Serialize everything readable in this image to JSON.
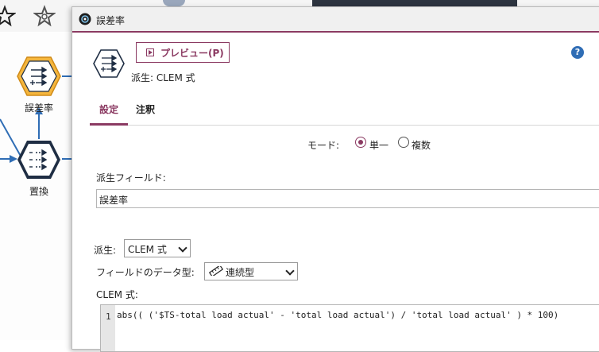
{
  "background": {
    "nodes": [
      {
        "label": "誤差率"
      },
      {
        "label": "置換"
      }
    ]
  },
  "dialog": {
    "title": "誤差率",
    "preview_label": "プレビュー(P)",
    "subtitle": "派生: CLEM 式",
    "help": "?",
    "tabs": [
      {
        "label": "設定",
        "active": true
      },
      {
        "label": "注釈",
        "active": false
      }
    ],
    "mode": {
      "label": "モード:",
      "options": [
        {
          "label": "単一",
          "selected": true
        },
        {
          "label": "複数",
          "selected": false
        }
      ]
    },
    "derive_field": {
      "label": "派生フィールド:",
      "value": "誤差率"
    },
    "derive_as": {
      "label": "派生:",
      "value": "CLEM 式"
    },
    "data_type": {
      "label": "フィールドのデータ型:",
      "value": "連続型"
    },
    "clem": {
      "label": "CLEM 式:",
      "line_number": "1",
      "expression": "abs(( ('$TS-total load actual' - 'total load actual') / 'total load actual' ) * 100)"
    }
  },
  "colors": {
    "accent": "#8b3a62",
    "help": "#2f6db5",
    "node_highlight": "#f5b63d",
    "node_dark": "#1f2e44",
    "connector": "#2f6db5"
  }
}
